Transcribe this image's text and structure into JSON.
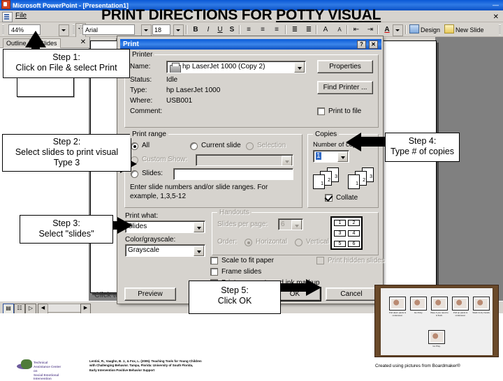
{
  "app": {
    "title": "Microsoft PowerPoint - [Presentation1]",
    "app_icon": "powerpoint-icon",
    "menus": [
      {
        "label": "File"
      }
    ],
    "toolbar": {
      "zoom_value": "44%",
      "font_name": "Arial",
      "font_size": "18",
      "bold": "B",
      "italic": "I",
      "underline": "U",
      "shadow": "S",
      "align_left": "≡",
      "align_center": "≡",
      "align_right": "≡",
      "numbering": "≣",
      "bullets": "≣",
      "increase_font": "A",
      "decrease_font": "A",
      "decrease_indent": "⇤",
      "increase_indent": "⇥",
      "font_color": "A",
      "design_label": "Design",
      "new_slide_label": "New Slide"
    },
    "outline_pane": {
      "tab_outline": "Outline",
      "tab_slides": "Slides",
      "close": "✕"
    },
    "status_bar": {
      "view_normal": "▤",
      "view_sorter": "☷",
      "view_show": "▷"
    },
    "slide": {
      "title_main": "PRINT DIRECTIONS FOR ",
      "title_underlined": "POTTY VISUAL",
      "placeholder": "Click to add"
    }
  },
  "print_dialog": {
    "title": "Print",
    "help_button": "?",
    "close_button": "✕",
    "printer_group": {
      "legend": "Printer",
      "name_label": "Name:",
      "name_value": "hp LaserJet 1000 (Copy 2)",
      "status_label": "Status:",
      "status_value": "Idle",
      "type_label": "Type:",
      "type_value": "hp LaserJet 1000",
      "where_label": "Where:",
      "where_value": "USB001",
      "comment_label": "Comment:",
      "comment_value": "",
      "properties_button": "Properties",
      "find_printer_button": "Find Printer ...",
      "print_to_file_label": "Print to file",
      "print_to_file_checked": false
    },
    "print_range": {
      "legend": "Print range",
      "all_label": "All",
      "all_selected": true,
      "current_slide_label": "Current slide",
      "current_slide_selected": false,
      "selection_label": "Selection",
      "selection_selected": false,
      "selection_disabled": true,
      "custom_show_label": "Custom Show:",
      "custom_show_selected": false,
      "custom_show_disabled": true,
      "custom_show_value": "",
      "slides_label": "Slides:",
      "slides_selected": false,
      "slides_value": "",
      "hint": "Enter slide numbers and/or slide ranges. For example, 1,3,5-12"
    },
    "copies": {
      "legend": "Copies",
      "number_label": "Number of copies:",
      "number_value": "1",
      "collate_label": "Collate",
      "collate_checked": true,
      "page_numbers": [
        "1",
        "2",
        "3",
        "1",
        "2",
        "3"
      ]
    },
    "print_what": {
      "label": "Print what:",
      "value": "Slides",
      "color_label": "Color/grayscale:",
      "color_value": "Grayscale"
    },
    "handouts": {
      "legend": "Handouts",
      "slides_per_page_label": "Slides per page:",
      "slides_per_page_value": "6",
      "order_label": "Order:",
      "horizontal_label": "Horizontal",
      "horizontal_selected": true,
      "vertical_label": "Vertical",
      "vertical_selected": false,
      "disabled": true,
      "preview_cells": [
        "1",
        "2",
        "3",
        "4",
        "5",
        "6"
      ]
    },
    "options": {
      "scale_to_fit_label": "Scale to fit paper",
      "scale_to_fit_checked": false,
      "frame_slides_label": "Frame slides",
      "frame_slides_checked": false,
      "print_comments_label": "Print comments and ink markup",
      "print_comments_checked": false,
      "print_hidden_label": "Print hidden slides",
      "print_hidden_checked": false,
      "print_hidden_disabled": true
    },
    "buttons": {
      "preview": "Preview",
      "ok": "OK",
      "cancel": "Cancel"
    }
  },
  "callouts": {
    "step1": {
      "line1": "Step 1:",
      "line2": "Click on File &  select Print"
    },
    "step2": {
      "line1": "Step 2:",
      "line2": "Select slides to print visual",
      "line3": "Type 3"
    },
    "step3": {
      "line1": "Step 3:",
      "line2": "Select \"slides\""
    },
    "step4": {
      "line1": "Step 4:",
      "line2": "Type # of copies"
    },
    "step5": {
      "line1": "Step 5:",
      "line2": "Click OK"
    }
  },
  "footer": {
    "citation_line1": "Lentini, R., Vaughn, B. J., & Fox, L. (2005). Teaching Tools for Young Children",
    "citation_line2": "with Challenging Behavior. Tampa, Florida: University of South Florida,",
    "citation_line3": "Early Intervention Positive Behavior Support",
    "logo_text_line1": "Technical Assistance Center on",
    "logo_text_line2": "Social Emotional Intervention",
    "boardmaker": "Created using pictures from Boardmaker®"
  },
  "photo": {
    "name": "potty-visual-photo",
    "cards": [
      {
        "caption": "Pull down pants & underwear."
      },
      {
        "caption": "Go Potty."
      },
      {
        "caption": "Wipe if you need to & flush."
      },
      {
        "caption": "Pull up pants & underwear."
      },
      {
        "caption": "Wash & dry hands."
      },
      {
        "caption": "Go Play."
      }
    ]
  },
  "colors": {
    "title_bar_blue": "#0b5bd8",
    "dialog_face": "#d6d3ce",
    "workspace_gray": "#808080",
    "disabled_gray": "#9a968f"
  }
}
